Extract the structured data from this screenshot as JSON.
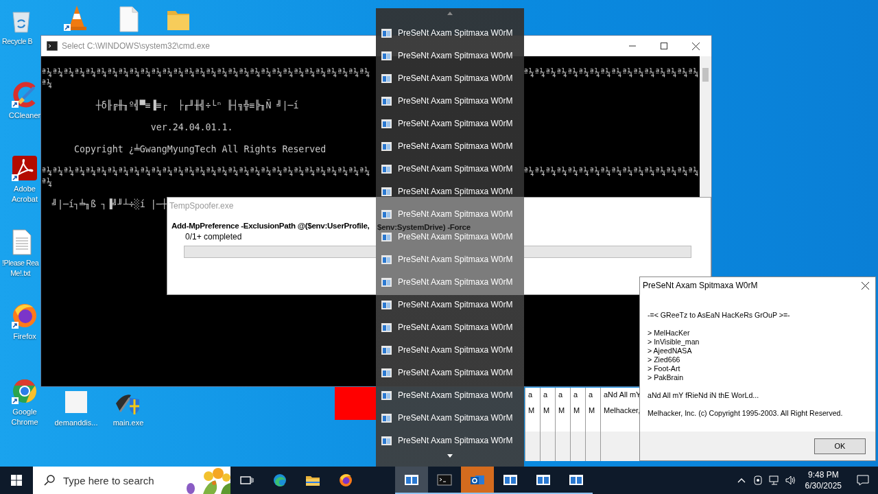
{
  "desktop": {
    "icons": [
      {
        "kind": "recycle-bin",
        "label": "Recycle B"
      },
      {
        "kind": "cone"
      },
      {
        "kind": "file"
      },
      {
        "kind": "folder"
      },
      {
        "kind": "cleaner",
        "label": "CCleaner"
      },
      {
        "kind": "pdf",
        "label": "Adobe\nAcrobat"
      },
      {
        "kind": "text-file",
        "label": "!Please Rea\nMe!.txt"
      },
      {
        "kind": "firefox",
        "label": "Firefox"
      },
      {
        "kind": "chrome",
        "label": "Google\nChrome"
      },
      {
        "kind": "blank",
        "label": "demanddis..."
      },
      {
        "kind": "installer",
        "label": "main.exe"
      }
    ]
  },
  "console": {
    "title": "Select C:\\WINDOWS\\system32\\cmd.exe",
    "lines": [
      {
        "left": "ª¼ª¼ª¼ª¼ª¼ª¼ª¼ª¼ª¼ª¼ª¼ª¼ª¼ª¼ª¼ª¼ª¼ª¼ª¼ª¼ª¼ª¼ª¼ª¼ª¼ª¼ª¼ª¼ª¼ª¼",
        "right": "ª¼ª¼ª¼ª¼ª¼ª¼ª¼ª¼ª¼ª¼ª¼ª¼ª¼ª¼ª¼ª¼"
      },
      {
        "left": "ª¼"
      },
      {
        "left": "          ┼δ╟╔╫╖º╣▀≡▐≡┌  ├╓╜╫╣÷└ⁿ ╟┤╗╬≡╠╖Ñ ╝|─í"
      },
      {
        "left": "                    ver.24.04.01.1."
      },
      {
        "left": "      Copyright ¿╧GwangMyungTech All Rights Reserved"
      },
      {
        "left": "ª¼ª¼ª¼ª¼ª¼ª¼ª¼ª¼ª¼ª¼ª¼ª¼ª¼ª¼ª¼ª¼ª¼ª¼ª¼ª¼ª¼ª¼ª¼ª¼ª¼ª¼ª¼ª¼ª¼ª¼",
        "right": "ª¼ª¼ª¼ª¼ª¼ª¼ª¼ª¼ª¼ª¼ª¼ª¼ª¼ª¼ª¼ª¼"
      },
      {
        "left": "ª¼"
      },
      {
        "left": "  ╝|─í┐╧╖ß ┐▐╝╜┴÷░í |─┼"
      }
    ]
  },
  "progress_dialog": {
    "title": "TempSpoofer.exe",
    "command_start": "Add-MpPreference -ExclusionPath @($env:UserProfile,",
    "command_end": "$env:SystemDrive) -Force",
    "status": "0/1+ completed",
    "level": 0
  },
  "ghost_columns": [
    {
      "top": "a",
      "bottom": "M"
    },
    {
      "top": "a",
      "bottom": "M"
    },
    {
      "top": "a",
      "bottom": "M"
    },
    {
      "top": "a",
      "bottom": "M"
    },
    {
      "top": "a",
      "bottom": "M"
    },
    {
      "top": "aNd All mY",
      "bottom": "Melhacker,"
    }
  ],
  "jump_list": {
    "items": [
      {
        "label": "PreSeNt Axam Spitmaxa W0rM"
      },
      {
        "label": "PreSeNt Axam Spitmaxa W0rM"
      },
      {
        "label": "PreSeNt Axam Spitmaxa W0rM"
      },
      {
        "label": "PreSeNt Axam Spitmaxa W0rM"
      },
      {
        "label": "PreSeNt Axam Spitmaxa W0rM"
      },
      {
        "label": "PreSeNt Axam Spitmaxa W0rM"
      },
      {
        "label": "PreSeNt Axam Spitmaxa W0rM"
      },
      {
        "label": "PreSeNt Axam Spitmaxa W0rM"
      },
      {
        "label": "PreSeNt Axam Spitmaxa W0rM"
      },
      {
        "label": "PreSeNt Axam Spitmaxa W0rM"
      },
      {
        "label": "PreSeNt Axam Spitmaxa W0rM"
      },
      {
        "label": "PreSeNt Axam Spitmaxa W0rM"
      },
      {
        "label": "PreSeNt Axam Spitmaxa W0rM"
      },
      {
        "label": "PreSeNt Axam Spitmaxa W0rM"
      },
      {
        "label": "PreSeNt Axam Spitmaxa W0rM"
      },
      {
        "label": "PreSeNt Axam Spitmaxa W0rM"
      },
      {
        "label": "PreSeNt Axam Spitmaxa W0rM"
      },
      {
        "label": "PreSeNt Axam Spitmaxa W0rM"
      },
      {
        "label": "PreSeNt Axam Spitmaxa W0rM"
      }
    ]
  },
  "message_box": {
    "title": "PreSeNt Axam Spitmaxa W0rM",
    "paragraphs": [
      "-=< GReeTz to AsEaN HacKeRs GrOuP >=-",
      "> MelHacKer\n> InVisible_man\n> AjeedNASA\n> Zied666\n> Foot-Art\n> PakBrain",
      "aNd All mY fRieNd iN thE WorLd...",
      "Melhacker, Inc. (c) Copyright 1995-2003. All Right Reserved."
    ],
    "button": "OK"
  },
  "taskbar": {
    "search_placeholder": "Type here to search",
    "pinned": [
      {
        "kind": "task-view"
      },
      {
        "kind": "edge"
      },
      {
        "kind": "folder"
      },
      {
        "kind": "firefox"
      }
    ],
    "apps": [
      {
        "kind": "window",
        "active": true,
        "flashing": false
      },
      {
        "kind": "console",
        "active": false,
        "flashing": false
      },
      {
        "kind": "mail",
        "active": false,
        "flashing": true
      },
      {
        "kind": "window",
        "active": false,
        "flashing": false
      },
      {
        "kind": "window",
        "active": false,
        "flashing": false
      },
      {
        "kind": "window",
        "active": false,
        "flashing": false
      }
    ],
    "time": "9:48 PM",
    "date": "6/30/2025"
  }
}
